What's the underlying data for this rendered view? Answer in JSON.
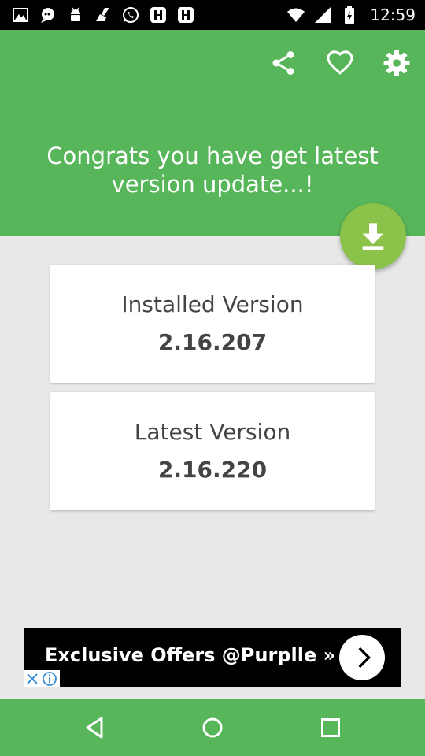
{
  "status_bar": {
    "time": "12:59",
    "left_icons": [
      "image-icon",
      "chat-icon",
      "android-icon",
      "cleaner-icon",
      "whatsapp-icon",
      "app-icon",
      "app-icon"
    ],
    "right_icons": [
      "wifi-icon",
      "signal-icon",
      "battery-icon"
    ]
  },
  "header": {
    "background": "#57b55a",
    "headline_line1": "Congrats you have get latest",
    "headline_line2": "version update...!",
    "actions": [
      "share-icon",
      "heart-icon",
      "gear-icon"
    ]
  },
  "fab": {
    "icon": "download-icon",
    "color": "#8bc34a"
  },
  "installed": {
    "title": "Installed Version",
    "value": "2.16.207"
  },
  "latest": {
    "title": "Latest Version",
    "value": "2.16.220"
  },
  "ad": {
    "text": "Exclusive Offers @Purplle »",
    "close_icon": "close-icon",
    "info_icon": "info-icon"
  },
  "nav": {
    "buttons": [
      "back-icon",
      "home-icon",
      "recents-icon"
    ]
  }
}
